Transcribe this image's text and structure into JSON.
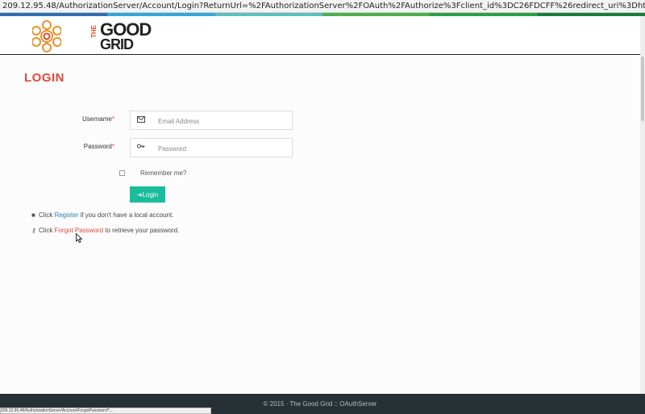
{
  "browser": {
    "address": "209.12.95.48/AuthorizationServer/Account/Login?ReturnUrl=%2FAuthorizationServer%2FOAuth%2FAuthorize%3Fclient_id%3DC26FDCFF%26redirect_uri%3Dhttp%253A%252F%252F209.12.95.",
    "status": "209.12.95.48/AuthorizationServer/Account/ForgotPassword?..."
  },
  "header": {
    "logo_the": "THE",
    "logo_good": "GOOD",
    "logo_grid": "GRID"
  },
  "colors": {
    "stripe": [
      "#2f6fb2",
      "#35a7d9",
      "#5bc0be",
      "#4caf50",
      "#2e9e44",
      "#1b7d3a"
    ],
    "accent": "#e1483c",
    "button": "#1bbc9b"
  },
  "page": {
    "title": "LOGIN"
  },
  "form": {
    "username_label": "Username",
    "password_label": "Password",
    "required_mark": "*",
    "username_placeholder": "Email Address",
    "password_placeholder": "Password",
    "username_icon": "envelope-icon",
    "password_icon": "key-icon",
    "remember_label": "Remember me?",
    "login_button": "Login"
  },
  "help": {
    "register_prefix": "Click ",
    "register_link": "Register",
    "register_suffix": " if you don't have a local account.",
    "forgot_prefix": "Click ",
    "forgot_link": "Forgot Password",
    "forgot_suffix": " to retrieve your password."
  },
  "footer": {
    "text": "© 2015 · The Good Grid :: OAuthServer"
  }
}
